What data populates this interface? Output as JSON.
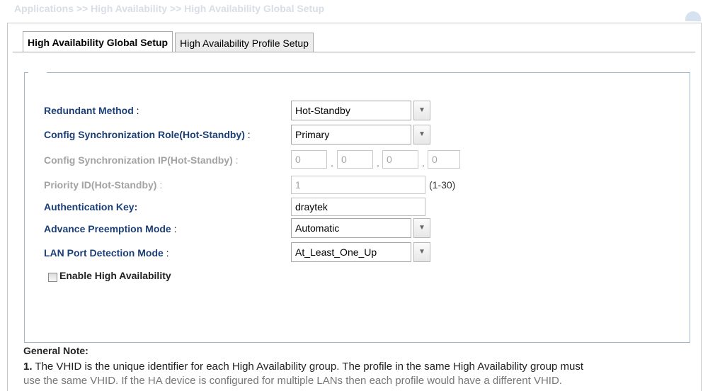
{
  "breadcrumb": "Applications >> High Availability >> High Availability Global Setup",
  "tabs": [
    {
      "label": "High Availability Global Setup",
      "active": true
    },
    {
      "label": "High Availability Profile Setup",
      "active": false
    }
  ],
  "form": {
    "redundant_method": {
      "label": "Redundant Method",
      "value": "Hot-Standby"
    },
    "sync_role": {
      "label": "Config Synchronization Role(Hot-Standby)",
      "value": "Primary"
    },
    "sync_ip": {
      "label": "Config Synchronization IP(Hot-Standby)",
      "octets": [
        "0",
        "0",
        "0",
        "0"
      ]
    },
    "priority_id": {
      "label": "Priority ID(Hot-Standby)",
      "value": "1",
      "range": "(1-30)"
    },
    "auth_key": {
      "label": "Authentication Key",
      "value": "draytek"
    },
    "preemption": {
      "label": "Advance Preemption Mode",
      "value": "Automatic"
    },
    "lan_detection": {
      "label": "LAN Port Detection Mode",
      "value": "At_Least_One_Up"
    },
    "enable_ha": {
      "label": "Enable High Availability",
      "checked": false
    }
  },
  "note": {
    "title": "General Note:",
    "number": "1.",
    "text": "The VHID is the unique identifier for each High Availability group. The profile in the same High Availability group must",
    "continuation": "use the same VHID. If the HA device is configured for multiple LANs then each profile would have a different VHID."
  }
}
